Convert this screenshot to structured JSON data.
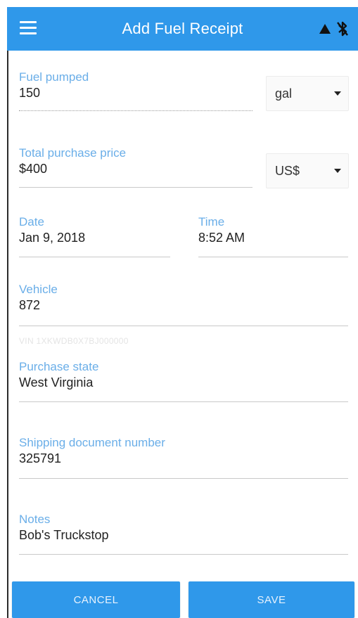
{
  "app_bar": {
    "title": "Add Fuel Receipt",
    "icons": [
      "menu-icon",
      "signal-triangle-icon",
      "bluetooth-disabled-icon"
    ],
    "background": "#2f98ea"
  },
  "form": {
    "fuel_pumped": {
      "label": "Fuel pumped",
      "value": "150",
      "unit": "gal"
    },
    "total_price": {
      "label": "Total purchase price",
      "value": "$400",
      "currency": "US$"
    },
    "date": {
      "label": "Date",
      "value": "Jan 9, 2018"
    },
    "time": {
      "label": "Time",
      "value": "8:52 AM"
    },
    "vehicle": {
      "label": "Vehicle",
      "value": "872",
      "hint": "VIN 1XKWDB0X7BJ000000"
    },
    "purchase_state": {
      "label": "Purchase state",
      "value": "West Virginia"
    },
    "shipping_doc": {
      "label": "Shipping document number",
      "value": "325791"
    },
    "notes": {
      "label": "Notes",
      "value": "Bob's Truckstop"
    }
  },
  "actions": {
    "cancel_label": "CANCEL",
    "save_label": "SAVE"
  },
  "colors": {
    "accent": "#2f98ea",
    "label": "#6aaee8",
    "text": "#222222"
  }
}
